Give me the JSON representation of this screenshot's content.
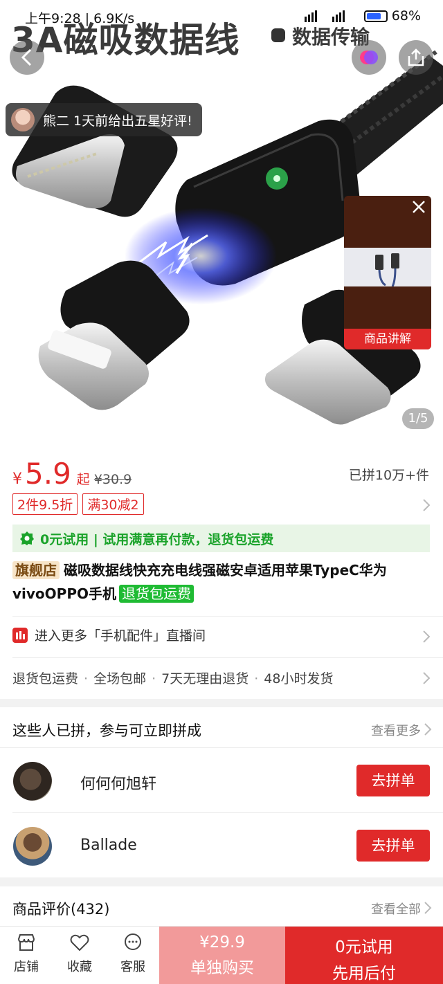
{
  "status_bar": {
    "time": "上午9:28",
    "speed": "6.9K/s",
    "battery": "68%"
  },
  "hero": {
    "title": "3A磁吸数据线",
    "subtitle": "数据传输",
    "toast_text": "熊二 1天前给出五星好评!",
    "video_label": "商品讲解",
    "page_indicator": "1/5"
  },
  "price": {
    "currency": "¥",
    "value": "5.9",
    "qi": "起",
    "original": "¥30.9",
    "sold": "已拼10万+件",
    "tags": [
      "2件9.5折",
      "满30减2"
    ]
  },
  "trial": {
    "text": "0元试用 | 试用满意再付款，退货包运费"
  },
  "product": {
    "shop_tag": "旗舰店",
    "title": "磁吸数据线快充充电线强磁安卓适用苹果TypeC华为vivoOPPO手机",
    "green_tag": "退货包运费"
  },
  "live": {
    "text": "进入更多「手机配件」直播间"
  },
  "services": [
    "退货包运费",
    "全场包邮",
    "7天无理由退货",
    "48小时发货"
  ],
  "group": {
    "heading": "这些人已拼，参与可立即拼成",
    "more": "查看更多",
    "rows": [
      {
        "name": "何何何旭轩",
        "button": "去拼单"
      },
      {
        "name": "Ballade",
        "button": "去拼单"
      }
    ]
  },
  "review": {
    "heading": "商品评价(432)",
    "more": "查看全部"
  },
  "bottom_bar": {
    "shop": "店铺",
    "favorite": "收藏",
    "service": "客服",
    "buy_alone_price": "¥29.9",
    "buy_alone_label": "单独购买",
    "try_label": "0元试用",
    "try_sub": "先用后付"
  },
  "colors": {
    "accent": "#e02a2a",
    "accent_light": "#f29a9a",
    "green": "#1aa32a"
  }
}
